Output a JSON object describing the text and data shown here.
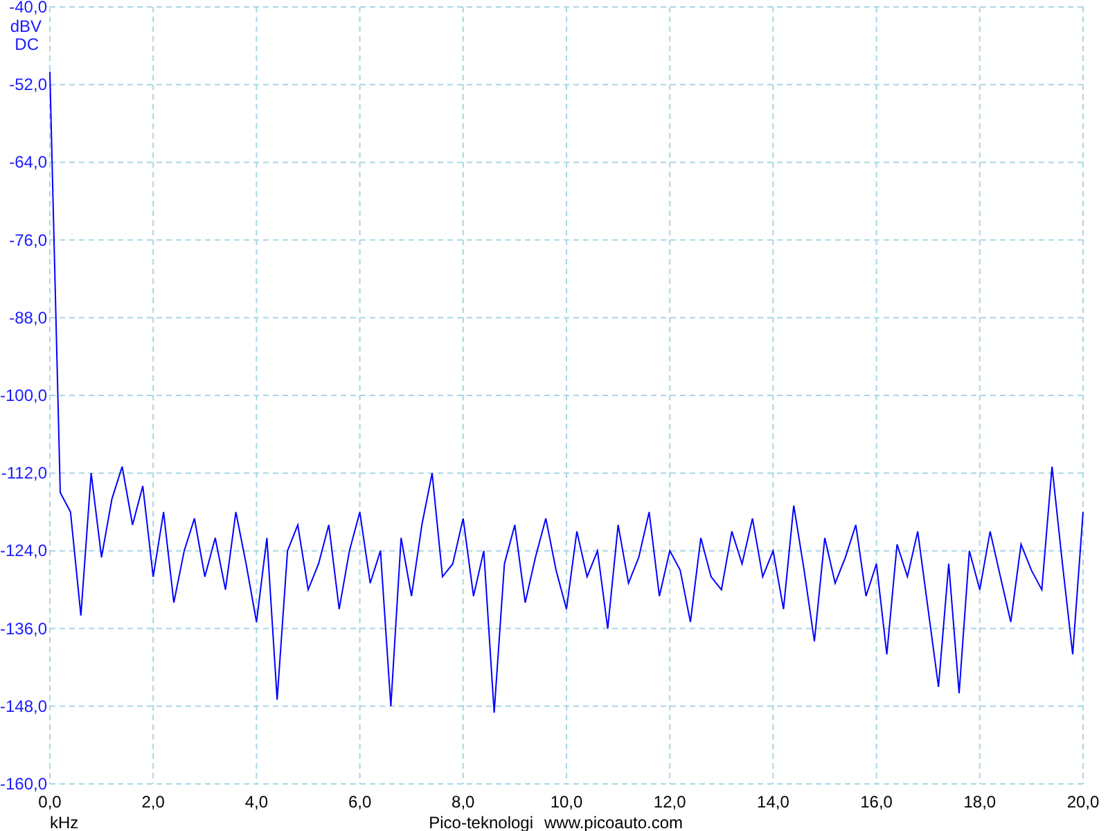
{
  "spectrum": {
    "chart_data": {
      "type": "line",
      "xlabel": "kHz",
      "ylabel": "dBV",
      "xlim": [
        0,
        20
      ],
      "ylim": [
        -160,
        -40
      ],
      "xticks": [
        {
          "value": 0,
          "label": "0,0"
        },
        {
          "value": 2,
          "label": "2,0"
        },
        {
          "value": 4,
          "label": "4,0"
        },
        {
          "value": 6,
          "label": "6,0"
        },
        {
          "value": 8,
          "label": "8,0"
        },
        {
          "value": 10,
          "label": "10,0"
        },
        {
          "value": 12,
          "label": "12,0"
        },
        {
          "value": 14,
          "label": "14,0"
        },
        {
          "value": 16,
          "label": "16,0"
        },
        {
          "value": 18,
          "label": "18,0"
        },
        {
          "value": 20,
          "label": "20,0"
        }
      ],
      "yticks": [
        {
          "value": -40,
          "label": "-40,0"
        },
        {
          "value": -52,
          "label": "-52,0"
        },
        {
          "value": -64,
          "label": "-64,0"
        },
        {
          "value": -76,
          "label": "-76,0"
        },
        {
          "value": -88,
          "label": "-88,0"
        },
        {
          "value": -100,
          "label": "-100,0"
        },
        {
          "value": -112,
          "label": "-112,0"
        },
        {
          "value": -124,
          "label": "-124,0"
        },
        {
          "value": -136,
          "label": "-136,0"
        },
        {
          "value": -148,
          "label": "-148,0"
        },
        {
          "value": -160,
          "label": "-160,0"
        }
      ],
      "x": [
        0,
        0.2,
        0.4,
        0.6,
        0.8,
        1,
        1.2,
        1.4,
        1.6,
        1.8,
        2,
        2.2,
        2.4,
        2.6,
        2.8,
        3,
        3.2,
        3.4,
        3.6,
        3.8,
        4,
        4.2,
        4.4,
        4.6,
        4.8,
        5,
        5.2,
        5.4,
        5.6,
        5.8,
        6,
        6.2,
        6.4,
        6.6,
        6.8,
        7,
        7.2,
        7.4,
        7.6,
        7.8,
        8,
        8.2,
        8.4,
        8.6,
        8.8,
        9,
        9.2,
        9.4,
        9.6,
        9.8,
        10,
        10.2,
        10.4,
        10.6,
        10.8,
        11,
        11.2,
        11.4,
        11.6,
        11.8,
        12,
        12.2,
        12.4,
        12.6,
        12.8,
        13,
        13.2,
        13.4,
        13.6,
        13.8,
        14,
        14.2,
        14.4,
        14.6,
        14.8,
        15,
        15.2,
        15.4,
        15.6,
        15.8,
        16,
        16.2,
        16.4,
        16.6,
        16.8,
        17,
        17.2,
        17.4,
        17.6,
        17.8,
        18,
        18.2,
        18.4,
        18.6,
        18.8,
        19,
        19.2,
        19.4,
        19.6,
        19.8,
        20
      ],
      "grid": true,
      "series": [
        {
          "color": "#0000ff",
          "values": [
            -50,
            -115,
            -118,
            -134,
            -112,
            -125,
            -116,
            -111,
            -120,
            -114,
            -128,
            -118,
            -132,
            -124,
            -119,
            -128,
            -122,
            -130,
            -118,
            -126,
            -135,
            -122,
            -147,
            -124,
            -120,
            -130,
            -126,
            -120,
            -133,
            -124,
            -118,
            -129,
            -124,
            -148,
            -122,
            -131,
            -120,
            -112,
            -128,
            -126,
            -119,
            -131,
            -124,
            -149,
            -126,
            -120,
            -132,
            -125,
            -119,
            -127,
            -133,
            -121,
            -128,
            -124,
            -136,
            -120,
            -129,
            -125,
            -118,
            -131,
            -124,
            -127,
            -135,
            -122,
            -128,
            -130,
            -121,
            -126,
            -119,
            -128,
            -124,
            -133,
            -117,
            -127,
            -138,
            -122,
            -129,
            -125,
            -120,
            -131,
            -126,
            -140,
            -123,
            -128,
            -121,
            -133,
            -145,
            -126,
            -146,
            -124,
            -130,
            -121,
            -128,
            -135,
            -123,
            -127,
            -130,
            -111,
            -126,
            -140,
            -118
          ]
        }
      ]
    },
    "coupling": "DC"
  },
  "footer": {
    "brand": "Pico-teknologi",
    "url": "www.picoauto.com"
  }
}
